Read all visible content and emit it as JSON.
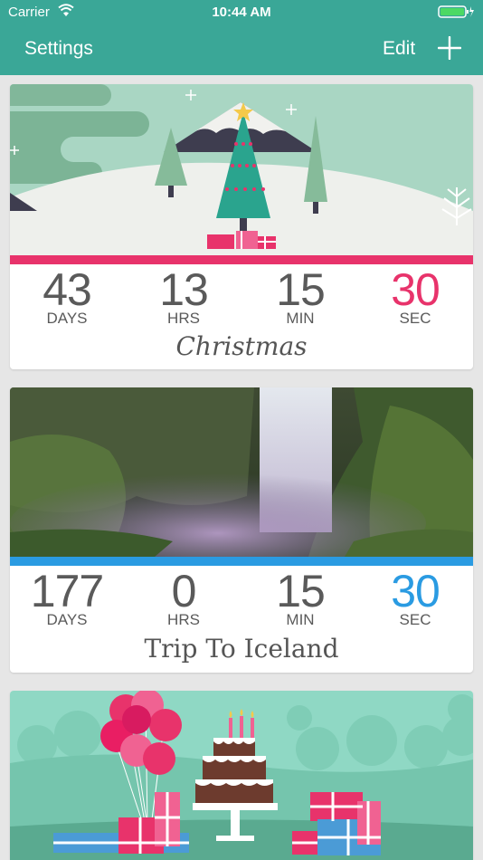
{
  "status_bar": {
    "carrier": "Carrier",
    "time": "10:44 AM"
  },
  "nav": {
    "settings": "Settings",
    "edit": "Edit"
  },
  "events": [
    {
      "days": "43",
      "hours": "13",
      "minutes": "15",
      "seconds": "30",
      "days_label": "DAYS",
      "hours_label": "HRS",
      "minutes_label": "MIN",
      "seconds_label": "SEC",
      "title": "Christmas",
      "accent": "#e8336b"
    },
    {
      "days": "177",
      "hours": "0",
      "minutes": "15",
      "seconds": "30",
      "days_label": "DAYS",
      "hours_label": "HRS",
      "minutes_label": "MIN",
      "seconds_label": "SEC",
      "title": "Trip To Iceland",
      "accent": "#2a9be2"
    }
  ],
  "colors": {
    "header": "#3aa797",
    "background": "#e6e6e6",
    "text": "#5a5a5a"
  }
}
